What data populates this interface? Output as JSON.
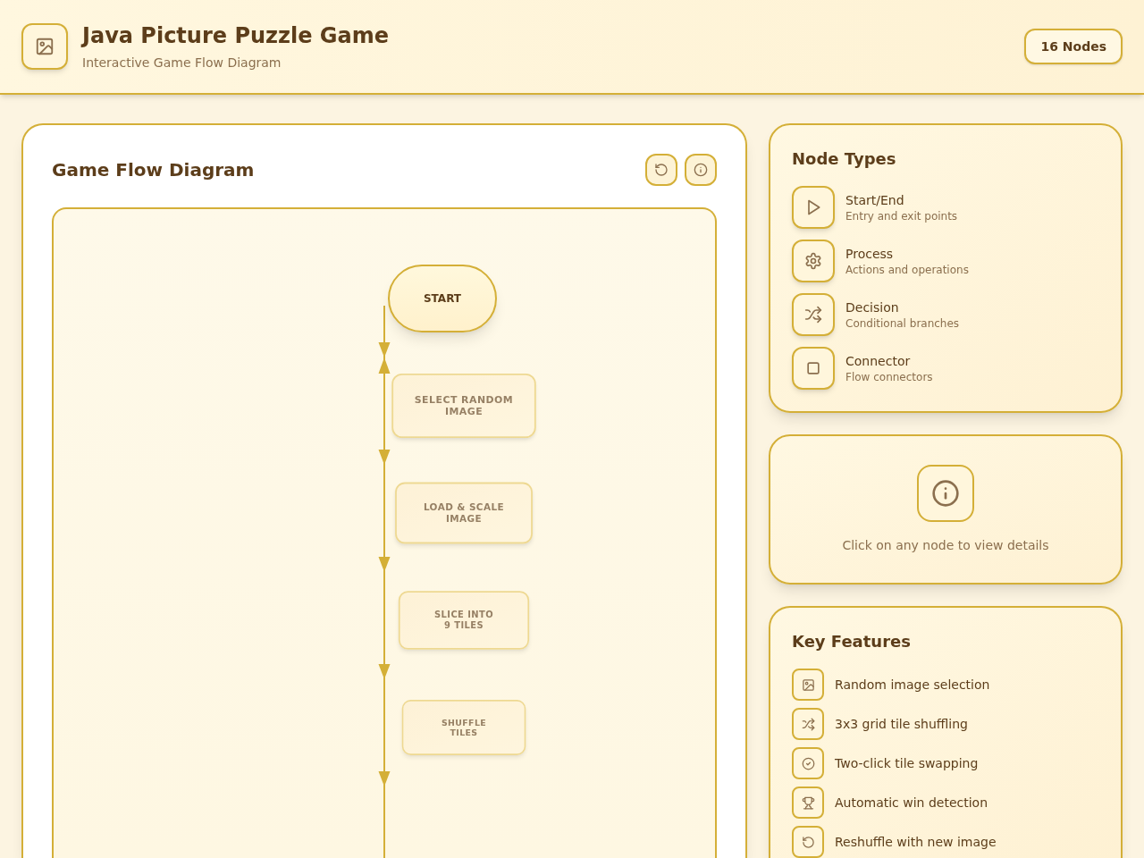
{
  "header": {
    "title": "Java Picture Puzzle Game",
    "subtitle": "Interactive Game Flow Diagram",
    "badge": "16 Nodes"
  },
  "diagram": {
    "title": "Game Flow Diagram",
    "nodes": [
      {
        "kind": "terminal",
        "label": "START",
        "dimmed": false
      },
      {
        "kind": "process",
        "label": "SELECT RANDOM IMAGE",
        "dimmed": true
      },
      {
        "kind": "process",
        "label": "LOAD & SCALE IMAGE",
        "dimmed": true
      },
      {
        "kind": "process",
        "label": "SLICE INTO 9 TILES",
        "dimmed": true
      },
      {
        "kind": "process",
        "label": "SHUFFLE TILES",
        "dimmed": true
      }
    ]
  },
  "node_types": {
    "title": "Node Types",
    "items": [
      {
        "kind": "start_end",
        "name": "Start/End",
        "description": "Entry and exit points"
      },
      {
        "kind": "process",
        "name": "Process",
        "description": "Actions and operations"
      },
      {
        "kind": "decision",
        "name": "Decision",
        "description": "Conditional branches"
      },
      {
        "kind": "connector",
        "name": "Connector",
        "description": "Flow connectors"
      }
    ]
  },
  "details": {
    "message": "Click on any node to view details"
  },
  "features": {
    "title": "Key Features",
    "items": [
      {
        "kind": "selection",
        "text": "Random image selection"
      },
      {
        "kind": "shuffling",
        "text": "3x3 grid tile shuffling"
      },
      {
        "kind": "swapping",
        "text": "Two-click tile swapping"
      },
      {
        "kind": "win",
        "text": "Automatic win detection"
      },
      {
        "kind": "reshuffle",
        "text": "Reshuffle with new image"
      }
    ]
  }
}
